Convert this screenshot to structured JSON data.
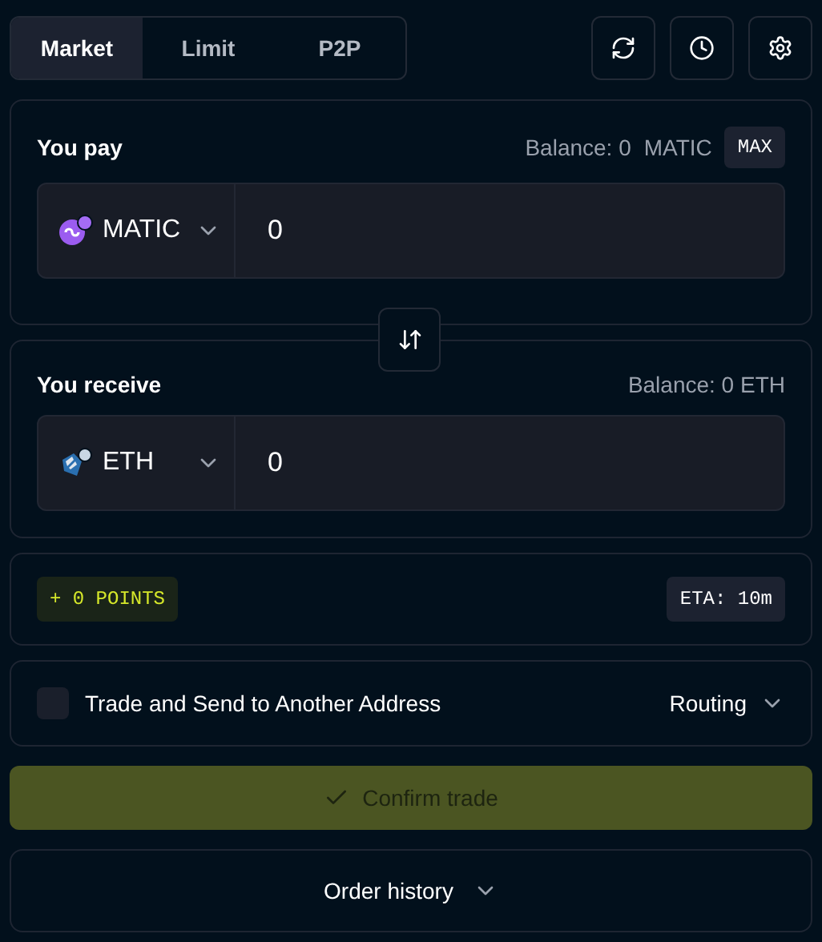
{
  "tabs": [
    {
      "label": "Market",
      "selected": true
    },
    {
      "label": "Limit",
      "selected": false
    },
    {
      "label": "P2P",
      "selected": false
    }
  ],
  "pay": {
    "title": "You pay",
    "balance": "Balance: 0",
    "balance_token": "MATIC",
    "max_label": "MAX",
    "token": "MATIC",
    "amount": "0"
  },
  "receive": {
    "title": "You receive",
    "balance": "Balance: 0 ETH",
    "token": "ETH",
    "amount": "0"
  },
  "points": "+ 0 POINTS",
  "eta": "ETA: 10m",
  "send_to_address": {
    "label": "Trade and Send to Another Address",
    "checked": false
  },
  "routing": "Routing",
  "confirm": {
    "label": "Confirm trade",
    "disabled": true
  },
  "order_history": "Order history"
}
